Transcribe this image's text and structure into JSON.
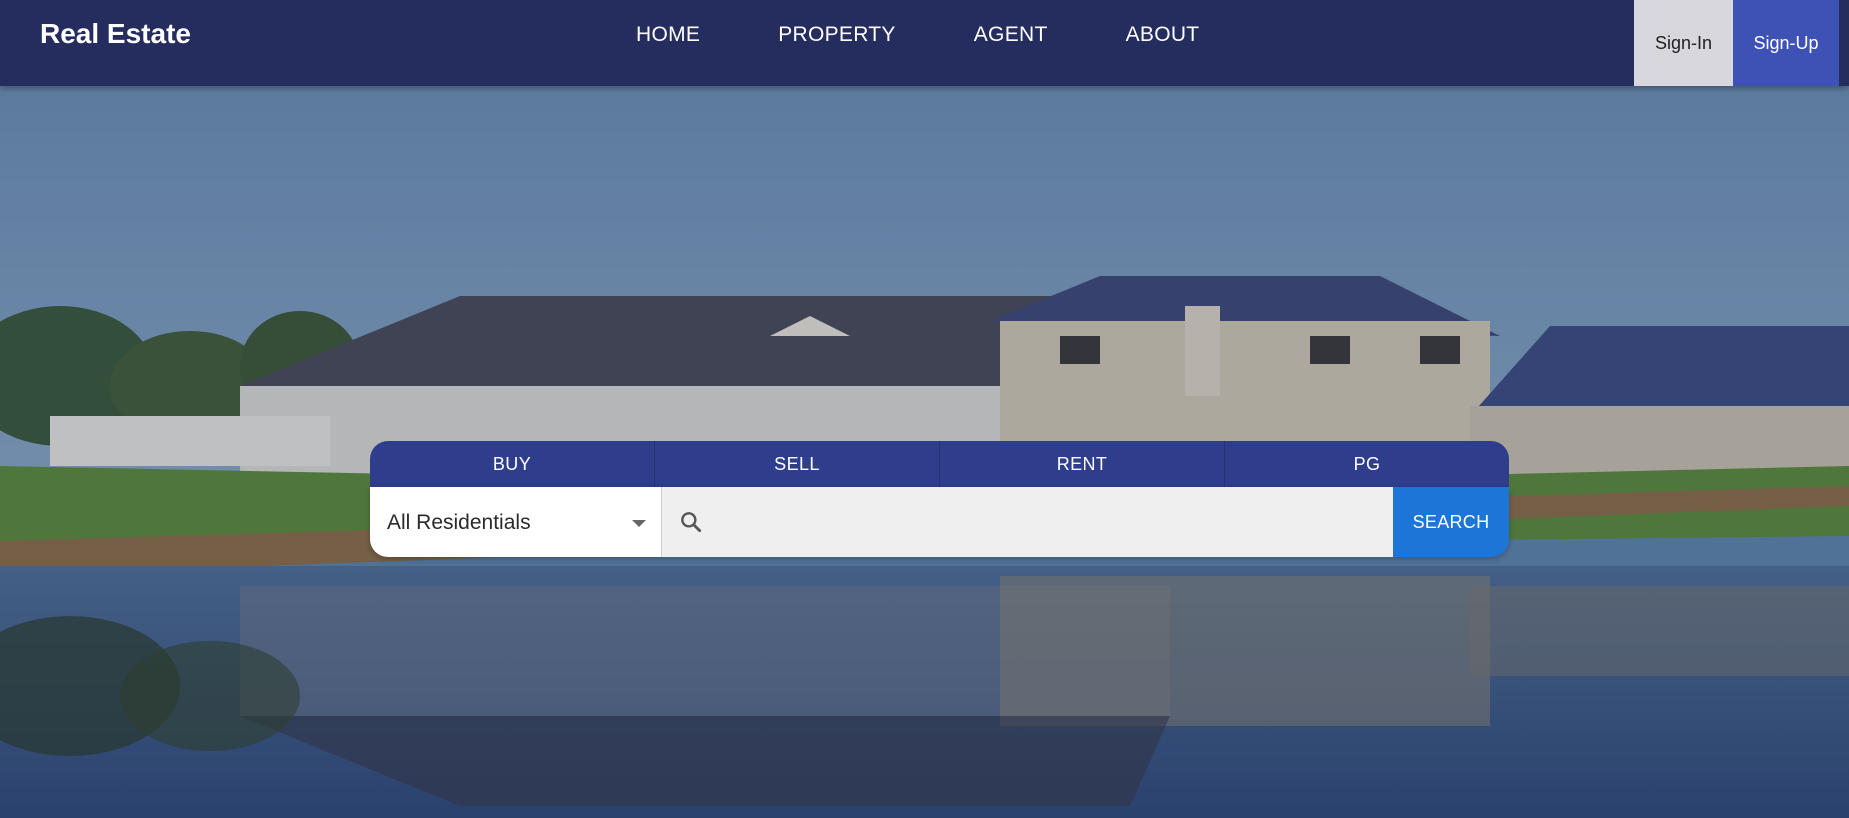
{
  "brand": "Real Estate",
  "nav": {
    "links": [
      "HOME",
      "PROPERTY",
      "AGENT",
      "ABOUT"
    ]
  },
  "auth": {
    "signin_label": "Sign-In",
    "signup_label": "Sign-Up"
  },
  "search": {
    "tabs": [
      "BUY",
      "SELL",
      "RENT",
      "PG"
    ],
    "property_type": "All Residentials",
    "query_value": "",
    "query_placeholder": "",
    "button_label": "SEARCH"
  },
  "colors": {
    "navbar": "#252c5e",
    "signup": "#3e51b5",
    "tabs": "#2f3d8d",
    "search_button": "#1d75d8"
  },
  "icons": {
    "search": "search-icon",
    "dropdown": "chevron-down-icon"
  }
}
